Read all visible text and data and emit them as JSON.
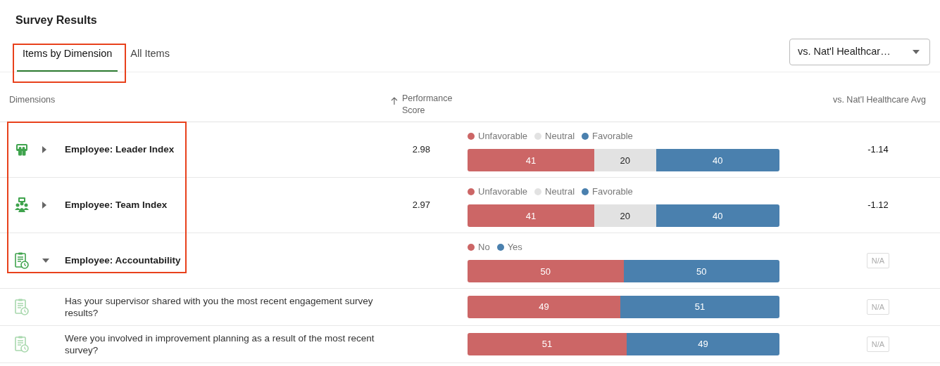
{
  "title": "Survey Results",
  "tabs": [
    {
      "label": "Items by Dimension",
      "selected": true
    },
    {
      "label": "All Items",
      "selected": false
    }
  ],
  "comparison_select": {
    "value": "vs. Nat'l Healthcar…"
  },
  "table": {
    "columns": {
      "dimensions": "Dimensions",
      "score": "Performance Score",
      "comparison": "vs. Nat'l Healthcare Avg"
    },
    "rows": [
      {
        "kind": "dimension",
        "name": "Employee: Leader Index",
        "expanded": false,
        "score": "2.98",
        "legend": [
          {
            "label": "Unfavorable",
            "color": "#cc6666"
          },
          {
            "label": "Neutral",
            "color": "#e2e2e2"
          },
          {
            "label": "Favorable",
            "color": "#4a80ae"
          }
        ],
        "segments": [
          {
            "value": "41",
            "color": "#cc6666"
          },
          {
            "value": "20",
            "color": "#e2e2e2"
          },
          {
            "value": "40",
            "color": "#4a80ae"
          }
        ],
        "comparison": {
          "kind": "value",
          "text": "-1.14"
        }
      },
      {
        "kind": "dimension",
        "name": "Employee: Team Index",
        "expanded": false,
        "score": "2.97",
        "legend": [
          {
            "label": "Unfavorable",
            "color": "#cc6666"
          },
          {
            "label": "Neutral",
            "color": "#e2e2e2"
          },
          {
            "label": "Favorable",
            "color": "#4a80ae"
          }
        ],
        "segments": [
          {
            "value": "41",
            "color": "#cc6666"
          },
          {
            "value": "20",
            "color": "#e2e2e2"
          },
          {
            "value": "40",
            "color": "#4a80ae"
          }
        ],
        "comparison": {
          "kind": "value",
          "text": "-1.12"
        }
      },
      {
        "kind": "dimension",
        "name": "Employee: Accountability",
        "expanded": true,
        "legend": [
          {
            "label": "No",
            "color": "#cc6666"
          },
          {
            "label": "Yes",
            "color": "#4a80ae"
          }
        ],
        "segments": [
          {
            "value": "50",
            "color": "#cc6666"
          },
          {
            "value": "50",
            "color": "#4a80ae"
          }
        ],
        "comparison": {
          "kind": "badge",
          "text": "N/A"
        }
      },
      {
        "kind": "item",
        "name": "Has your supervisor shared with you the most recent engagement survey results?",
        "segments": [
          {
            "value": "49",
            "color": "#cc6666"
          },
          {
            "value": "51",
            "color": "#4a80ae"
          }
        ],
        "comparison": {
          "kind": "badge",
          "text": "N/A"
        }
      },
      {
        "kind": "item",
        "name": "Were you involved in improvement planning as a result of the most recent survey?",
        "segments": [
          {
            "value": "51",
            "color": "#cc6666"
          },
          {
            "value": "49",
            "color": "#4a80ae"
          }
        ],
        "comparison": {
          "kind": "badge",
          "text": "N/A"
        }
      }
    ]
  }
}
